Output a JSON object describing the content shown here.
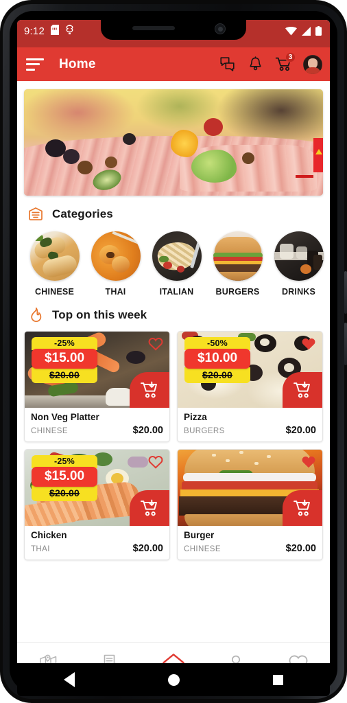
{
  "status_bar": {
    "clock": "9:12",
    "icons": [
      "sd-card-icon",
      "usb-debug-icon",
      "wifi-icon",
      "signal-icon",
      "battery-icon"
    ]
  },
  "app_bar": {
    "menu_icon": "hamburger-menu-icon",
    "title": "Home",
    "actions": [
      {
        "name": "chat-icon",
        "label": "Chat"
      },
      {
        "name": "notification-bell-icon",
        "label": "Notifications"
      },
      {
        "name": "cart-icon",
        "label": "Cart",
        "badge": "3"
      },
      {
        "name": "avatar",
        "label": "Profile"
      }
    ],
    "cart_badge": "3",
    "bg_color": "#e03a32"
  },
  "hero": {
    "name": "promo-banner",
    "alt": "Assorted cold cuts platter banner"
  },
  "categories_section": {
    "icon": "categories-tray-icon",
    "title": "Categories",
    "items": [
      {
        "label": "CHINESE",
        "image": "spring-rolls"
      },
      {
        "label": "THAI",
        "image": "thai-chicken-chopsticks"
      },
      {
        "label": "ITALIAN",
        "image": "pasta-salad"
      },
      {
        "label": "BURGERS",
        "image": "cheeseburger"
      },
      {
        "label": "DRINKS",
        "image": "bar-drinks"
      }
    ]
  },
  "top_section": {
    "icon": "flame-icon",
    "title": "Top on this week",
    "products": [
      {
        "name": "Non Veg Platter",
        "category": "CHINESE",
        "discount": "-25%",
        "sale_price": "$15.00",
        "old_price": "$20.00",
        "price": "$20.00",
        "favorite": false,
        "image": "seafood-platter"
      },
      {
        "name": "Pizza",
        "category": "BURGERS",
        "discount": "-50%",
        "sale_price": "$10.00",
        "old_price": "$20.00",
        "price": "$20.00",
        "favorite": true,
        "image": "olive-pizza"
      },
      {
        "name": "Chicken",
        "category": "THAI",
        "discount": "-25%",
        "sale_price": "$15.00",
        "old_price": "$20.00",
        "price": "$20.00",
        "favorite": false,
        "image": "grilled-salmon-salad"
      },
      {
        "name": "Burger",
        "category": "CHINESE",
        "discount": "",
        "sale_price": "",
        "old_price": "",
        "price": "$20.00",
        "favorite": true,
        "image": "cheeseburger-flame"
      }
    ]
  },
  "bottom_nav": {
    "items": [
      {
        "name": "map-icon",
        "label": "Map",
        "active": false
      },
      {
        "name": "orders-icon",
        "label": "Orders",
        "active": false
      },
      {
        "name": "home-icon",
        "label": "Home",
        "active": true
      },
      {
        "name": "profile-icon",
        "label": "Profile",
        "active": false
      },
      {
        "name": "favorites-heart-icon",
        "label": "Favorites",
        "active": false
      }
    ],
    "active_color": "#e03a32",
    "inactive_color": "#b4b4b4"
  },
  "android_nav": {
    "back": "back-button",
    "home": "home-button",
    "recents": "recents-button"
  },
  "colors": {
    "brand_red": "#e03a32",
    "status_red": "#b5302b",
    "badge_yellow": "#f7e021",
    "badge_red": "#f0372d",
    "accent_orange": "#e8772e"
  }
}
